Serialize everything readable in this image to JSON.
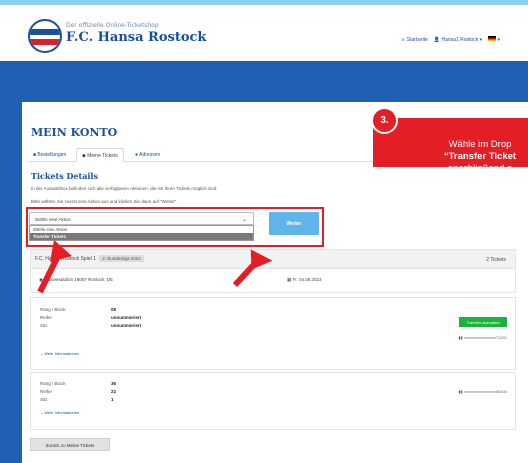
{
  "header": {
    "subtitle": "Der offizielle Online-Ticketshop",
    "title": "F.C. Hansa Rostock",
    "nav": {
      "home": "Startseite",
      "user": "Hansa1 Rostock"
    }
  },
  "page": {
    "heading": "MEIN KONTO",
    "tabs": [
      {
        "label": "Bestellungen"
      },
      {
        "label": "Meine Tickets"
      },
      {
        "label": "Adressen"
      }
    ]
  },
  "ticket_details": {
    "heading": "Tickets Details",
    "info": "In der Auswahlbox befinden sich alle verfügbaren Aktionen, die mit Ihren Tickets möglich sind.",
    "instruction": "Bitte wählen Sie zuerst eine Aktion aus und klicken Sie dann auf \"Weiter\".",
    "select_value": "Wähle eine Aktion",
    "options": [
      "Wähle eine Aktion",
      "Transfer Tickets"
    ],
    "button": "Weiter"
  },
  "event": {
    "name": "F.C. Hansa Rostock Spiel 1",
    "league": "2. Bundesliga 2024",
    "tickets": "2 Tickets",
    "venue": "Ostseestadion 18057 Rostock, DE",
    "date": "Fr. 04.08.2023"
  },
  "tickets": [
    {
      "labels": [
        "Rang / Block",
        "Reihe",
        "Sitz"
      ],
      "values": [
        "08",
        "unnummeriert",
        "unnummeriert"
      ],
      "status": "Transfer akzeptiert",
      "id": "xxxxxxxxxxxxxxxx71201",
      "more": "Mehr Informationen"
    },
    {
      "labels": [
        "Rang / Block",
        "Reihe",
        "Sitz"
      ],
      "values": [
        "36",
        "22",
        "1"
      ],
      "status": "",
      "id": "xxxxxxxxxxxxxxxx80400",
      "more": "Mehr Informationen"
    }
  ],
  "back_button": "Zurück zu Meine Tickets",
  "callout": {
    "step": "3.",
    "line1": "Wähle im Drop",
    "line2": "“Transfer Ticket",
    "line3": "anschließend a"
  },
  "colors": {
    "brand": "#1a4f9c",
    "accent_red": "#e31e24",
    "button_blue": "#5fb4ea",
    "success": "#1db33b"
  }
}
